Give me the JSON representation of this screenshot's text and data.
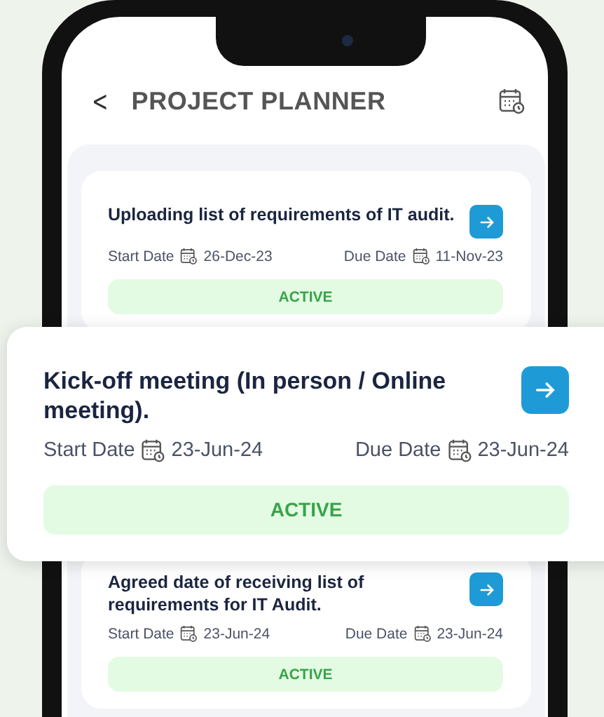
{
  "header": {
    "back": "<",
    "title": "PROJECT PLANNER"
  },
  "tasks": [
    {
      "title": "Uploading list of requirements of IT audit.",
      "start_label": "Start Date",
      "start": "26-Dec-23",
      "due_label": "Due Date",
      "due": "11-Nov-23",
      "status": {
        "label": "ACTIVE",
        "kind": "active"
      }
    },
    {
      "title": "Agreed date of receiving list of requirements for IT Audit.",
      "start_label": "Start Date",
      "start": "23-Jun-24",
      "due_label": "Due Date",
      "due": "23-Jun-24",
      "status": {
        "label": "ACTIVE",
        "kind": "active"
      }
    }
  ],
  "featured_task": {
    "title": "Kick-off meeting (In person / Online meeting).",
    "start_label": "Start Date",
    "start": "23-Jun-24",
    "due_label": "Due Date",
    "due": "23-Jun-24",
    "status": {
      "label": "ACTIVE",
      "kind": "active"
    }
  }
}
